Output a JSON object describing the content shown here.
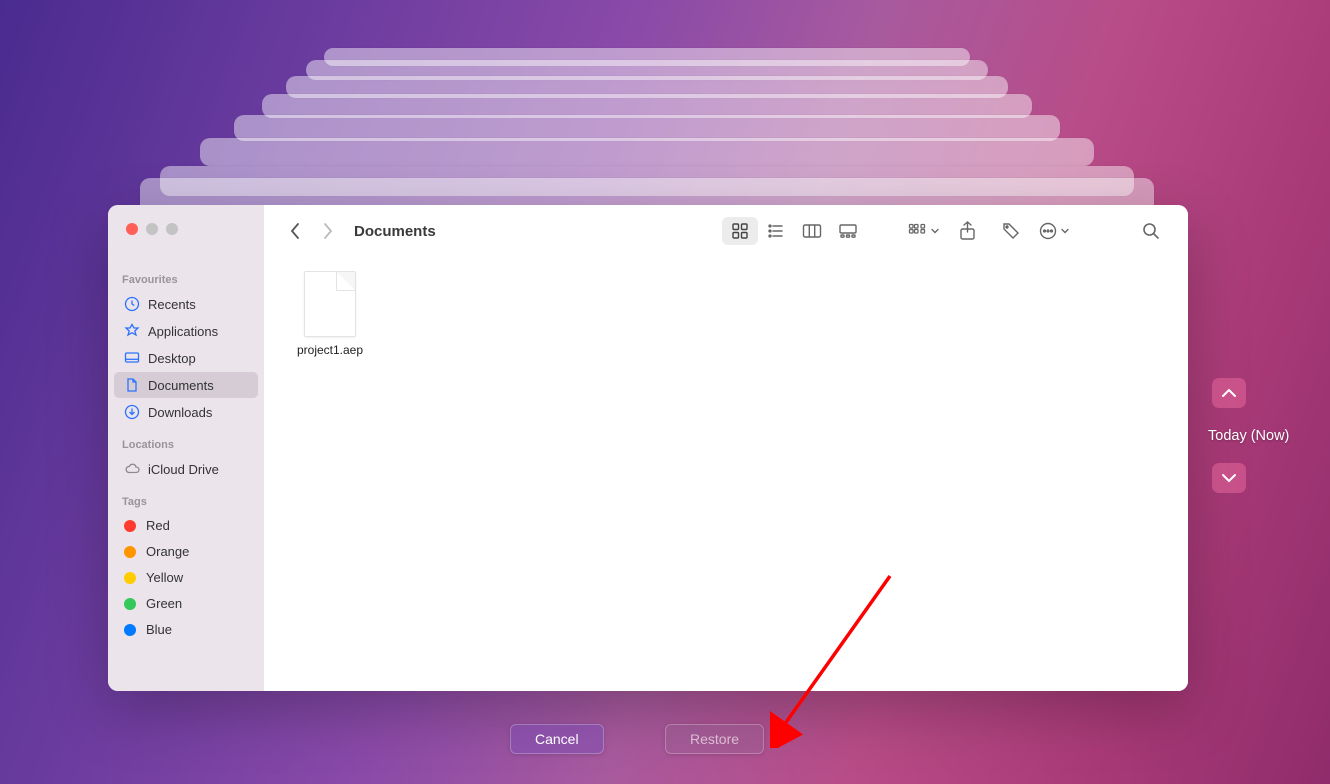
{
  "window_title": "Documents",
  "sidebar": {
    "sections": {
      "favourites_label": "Favourites",
      "locations_label": "Locations",
      "tags_label": "Tags"
    },
    "favourites": [
      {
        "label": "Recents"
      },
      {
        "label": "Applications"
      },
      {
        "label": "Desktop"
      },
      {
        "label": "Documents"
      },
      {
        "label": "Downloads"
      }
    ],
    "locations": [
      {
        "label": "iCloud Drive"
      }
    ],
    "tags": [
      {
        "label": "Red",
        "color": "#ff3b30"
      },
      {
        "label": "Orange",
        "color": "#ff9500"
      },
      {
        "label": "Yellow",
        "color": "#ffcc00"
      },
      {
        "label": "Green",
        "color": "#34c759"
      },
      {
        "label": "Blue",
        "color": "#007aff"
      }
    ]
  },
  "files": [
    {
      "name": "project1.aep"
    }
  ],
  "timeline": {
    "label": "Today (Now)"
  },
  "footer": {
    "cancel": "Cancel",
    "restore": "Restore"
  }
}
